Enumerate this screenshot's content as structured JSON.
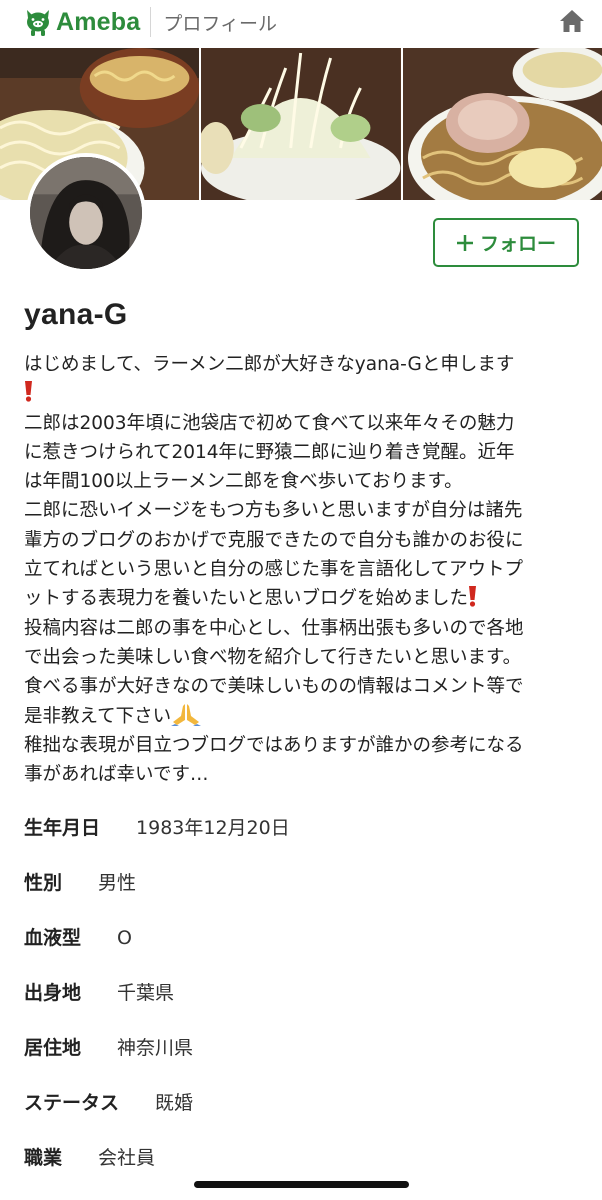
{
  "header": {
    "logo_text": "Ameba",
    "title": "プロフィール",
    "logo_icon": "ameba-pig-logo",
    "home_icon": "home-icon",
    "brand_color": "#2d8c3c"
  },
  "cover": {
    "photos": [
      "ramen-photo",
      "ramen-photo",
      "ramen-photo"
    ]
  },
  "profile": {
    "avatar": "profile-avatar",
    "follow_label": "フォロー",
    "name": "yana-G"
  },
  "bio": {
    "lines": [
      "はじめまして、ラーメン二郎が大好きなyana-Gと申します",
      "",
      "二郎は2003年頃に池袋店で初めて食べて以来年々その魅力",
      "に惹きつけられて2014年に野猿二郎に辿り着き覚醒。近年",
      "は年間100以上ラーメン二郎を食べ歩いております。",
      "二郎に恐いイメージをもつ方も多いと思いますが自分は諸先",
      "輩方のブログのおかげで克服できたので自分も誰かのお役に",
      "立てればという思いと自分の感じた事を言語化してアウトプ",
      "ットする表現力を養いたいと思いブログを始めました",
      "投稿内容は二郎の事を中心とし、仕事柄出張も多いので各地",
      "で出会った美味しい食べ物を紹介して行きたいと思います。",
      "食べる事が大好きなので美味しいものの情報はコメント等で",
      "是非教えて下さい",
      "稚拙な表現が目立つブログではありますが誰かの参考になる",
      "事があれば幸いです…"
    ]
  },
  "info": [
    {
      "label": "生年月日",
      "value": "1983年12月20日"
    },
    {
      "label": "性別",
      "value": "男性"
    },
    {
      "label": "血液型",
      "value": "O"
    },
    {
      "label": "出身地",
      "value": "千葉県"
    },
    {
      "label": "居住地",
      "value": "神奈川県"
    },
    {
      "label": "ステータス",
      "value": "既婚"
    },
    {
      "label": "職業",
      "value": "会社員"
    }
  ]
}
